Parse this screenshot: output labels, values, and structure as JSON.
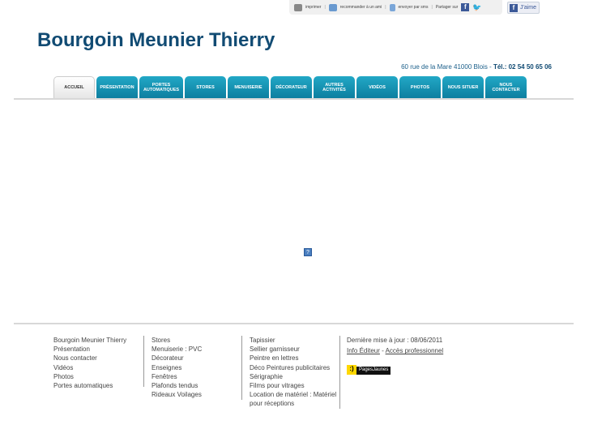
{
  "toolbar": {
    "print": "imprimer",
    "recommend": "recommander à un ami",
    "sms": "envoyer par sms",
    "share": "Partager sur",
    "like": "J'aime"
  },
  "header": {
    "title": "Bourgoin Meunier Thierry",
    "address": "60 rue de la Mare 41000 Blois  - ",
    "phone": "Tél.: 02 54 50 65 06"
  },
  "tabs": [
    {
      "label": "ACCUEIL"
    },
    {
      "label": "PRÉSENTATION"
    },
    {
      "label": "PORTES AUTOMATIQUES"
    },
    {
      "label": "STORES"
    },
    {
      "label": "MENUISERIE"
    },
    {
      "label": "DÉCORATEUR"
    },
    {
      "label": "AUTRES ACTIVITÉS"
    },
    {
      "label": "VIDÉOS"
    },
    {
      "label": "PHOTOS"
    },
    {
      "label": "NOUS SITUER"
    },
    {
      "label": "NOUS CONTACTER"
    }
  ],
  "main": {
    "placeholder_icon": "?"
  },
  "footer": {
    "col1": [
      "Bourgoin Meunier Thierry",
      "Présentation",
      "Nous contacter",
      "Vidéos",
      "Photos",
      "Portes automatiques"
    ],
    "col2": [
      "Stores",
      "Menuiserie : PVC",
      "Décorateur",
      "Enseignes",
      "Fenêtres",
      "Plafonds tendus",
      "Rideaux Voilages"
    ],
    "col3": [
      "Tapissier",
      "Sellier garnisseur",
      "Peintre en lettres",
      "Déco Peintures publicitaires",
      "Sérigraphie",
      "Films pour vitrages",
      "Location de matériel : Matériel",
      "pour réceptions"
    ],
    "updated": "Dernière mise à jour : 08/06/2011",
    "info_editeur": "Info Éditeur",
    "dash": " - ",
    "pro": "Accès professionnel",
    "pj": "PagesJaunes",
    "pj_logo": ":)"
  }
}
